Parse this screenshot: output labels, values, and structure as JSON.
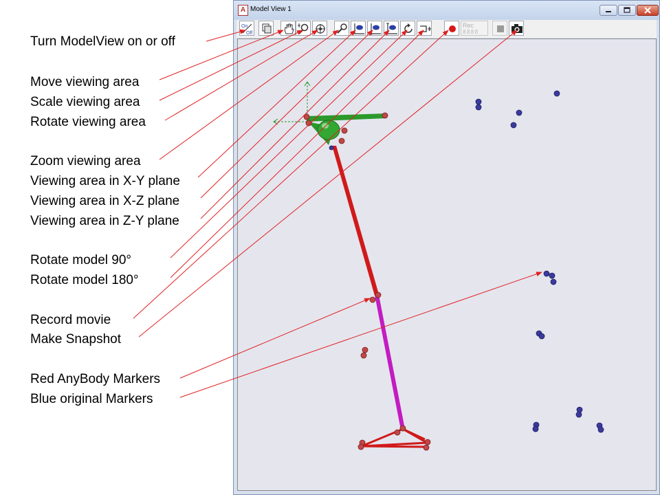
{
  "annotations": [
    "Turn ModelView on or off",
    "Move viewing area",
    "Scale viewing area",
    "Rotate viewing area",
    "Zoom viewing area",
    "Viewing area in X-Y plane",
    "Viewing area in X-Z plane",
    "Viewing area in Z-Y plane",
    "Rotate model 90°",
    "Rotate model 180°",
    "Record movie",
    "Make Snapshot",
    "Red AnyBody Markers",
    "Blue original Markers"
  ],
  "window": {
    "title": "Model View 1",
    "app_icon_letter": "A"
  },
  "toolbar": {
    "on_off": {
      "on": "On",
      "off": "Off"
    },
    "rec_label": "Rec",
    "rec_counter": "8888"
  },
  "colors": {
    "arrow": "#e02020",
    "red_marker": "#c04848",
    "blue_marker": "#3a3a9e",
    "green_segment": "#2a9a2a",
    "red_segment": "#d01a1a",
    "magenta_segment": "#c21cc2",
    "viewport_bg": "#e5e5ee"
  },
  "icons": [
    "on-off-toggle-icon",
    "copy-icon",
    "hand-pan-icon",
    "scale-magnifier-icon",
    "rotate-view-icon",
    "zoom-magnifier-icon",
    "xy-plane-icon",
    "xz-plane-icon",
    "zy-plane-icon",
    "rotate-90-icon",
    "rotate-180-icon",
    "record-icon",
    "stop-icon",
    "camera-icon"
  ]
}
